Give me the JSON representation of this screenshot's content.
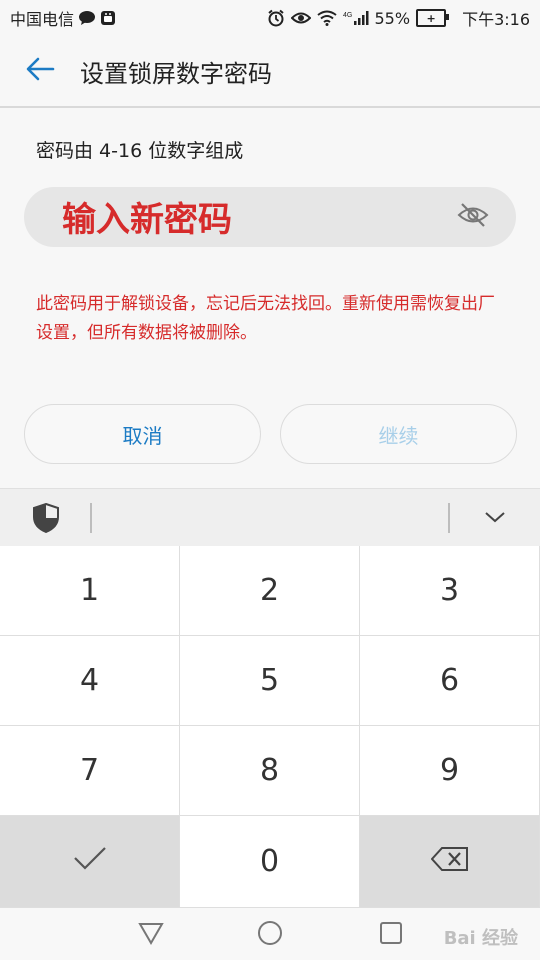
{
  "status_bar": {
    "carrier": "中国电信",
    "battery_percent": "55%",
    "battery_level": "",
    "time": "下午3:16",
    "network_type": "4G",
    "icons": [
      "chat-bubble-icon",
      "android-icon",
      "alarm-icon",
      "eye-comfort-icon",
      "wifi-icon",
      "cellular-signal-icon",
      "battery-icon"
    ]
  },
  "header": {
    "back_icon": "arrow-left-icon",
    "title": "设置锁屏数字密码"
  },
  "hint": "密码由 4-16 位数字组成",
  "password_field": {
    "placeholder": "输入新密码",
    "visibility_icon": "eye-off-icon"
  },
  "warning": "此密码用于解锁设备，忘记后无法找回。重新使用需恢复出厂设置，但所有数据将被删除。",
  "buttons": {
    "cancel": "取消",
    "continue": "继续"
  },
  "keyboard": {
    "toolbar_icons": [
      "shield-icon",
      "chevron-down-icon"
    ],
    "keys": [
      "1",
      "2",
      "3",
      "4",
      "5",
      "6",
      "7",
      "8",
      "9"
    ],
    "zero": "0",
    "confirm_icon": "checkmark-icon",
    "delete_icon": "backspace-icon"
  },
  "nav_bar": {
    "icons": [
      "back-triangle-icon",
      "home-circle-icon",
      "recents-square-icon"
    ]
  },
  "watermark": "Bai 经验",
  "colors": {
    "accent": "#1c7bc4",
    "warning": "#d62b2b",
    "disabled": "#a8cfe9"
  }
}
